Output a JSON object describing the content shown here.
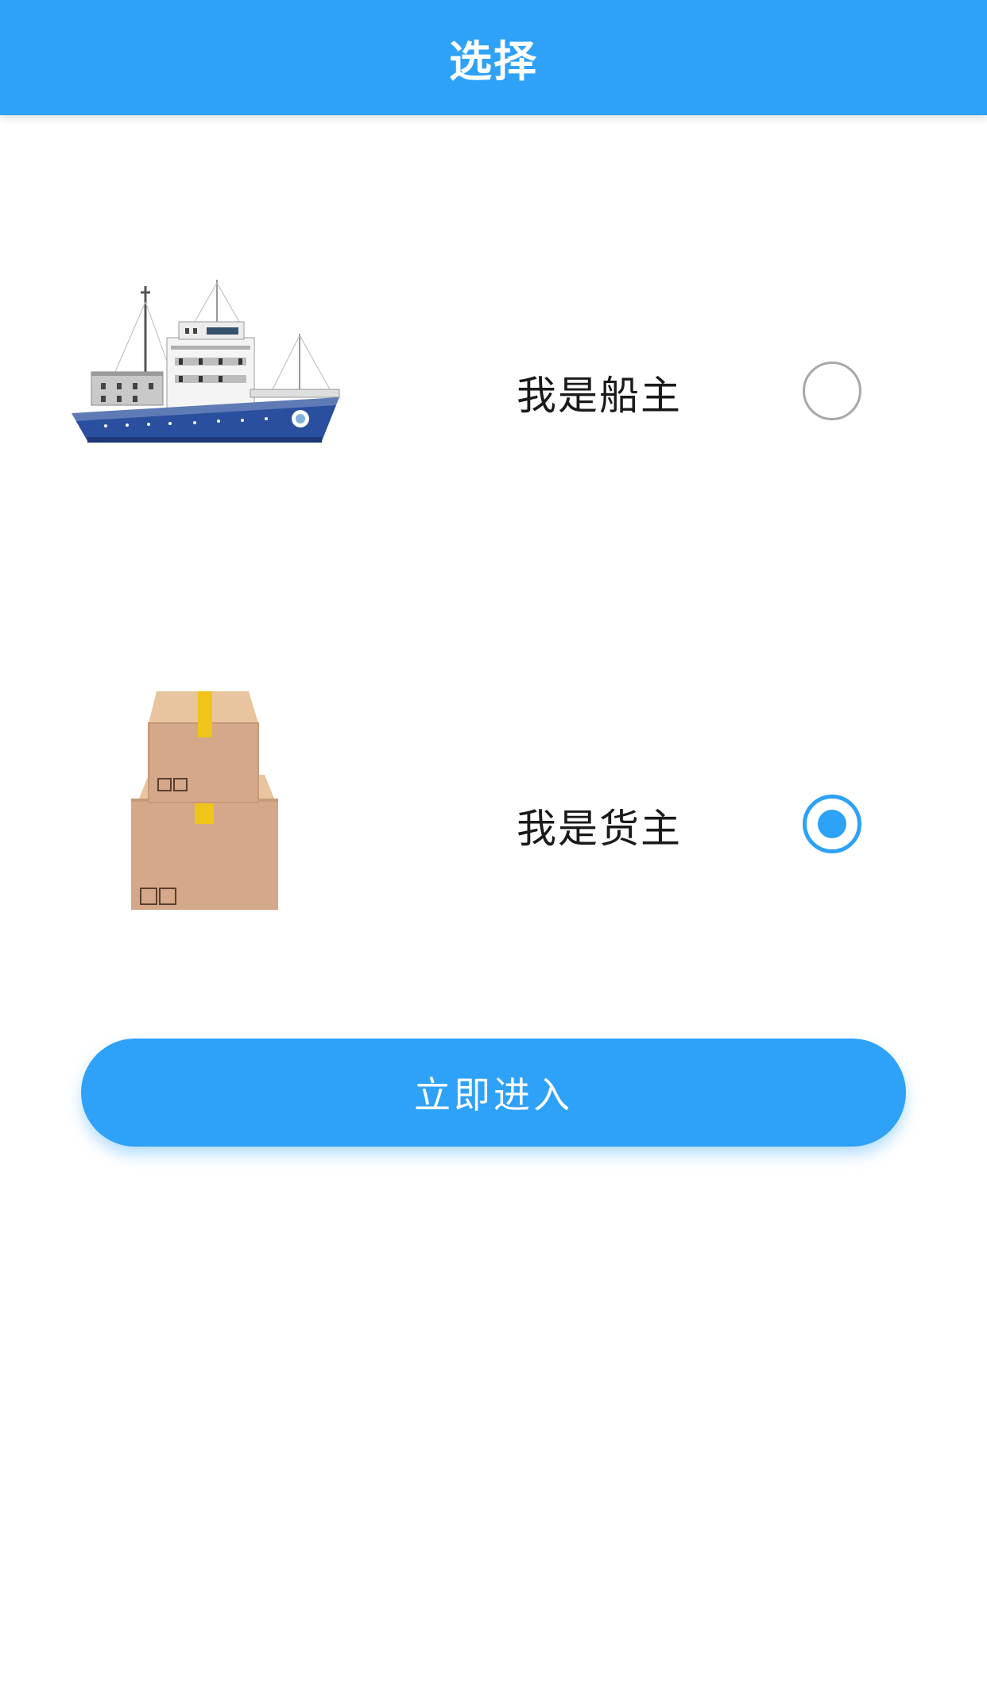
{
  "header": {
    "title": "选择"
  },
  "roles": [
    {
      "label": "我是船主",
      "icon": "ship-illustration",
      "selected": false
    },
    {
      "label": "我是货主",
      "icon": "cargo-boxes-illustration",
      "selected": true
    }
  ],
  "enter_button": {
    "label": "立即进入"
  },
  "colors": {
    "accent": "#2ea1f8",
    "radio_unselected_border": "#a8a8a8",
    "ship_hull": "#2a4f9e",
    "box": "#d4a888",
    "tape": "#f0c419"
  }
}
